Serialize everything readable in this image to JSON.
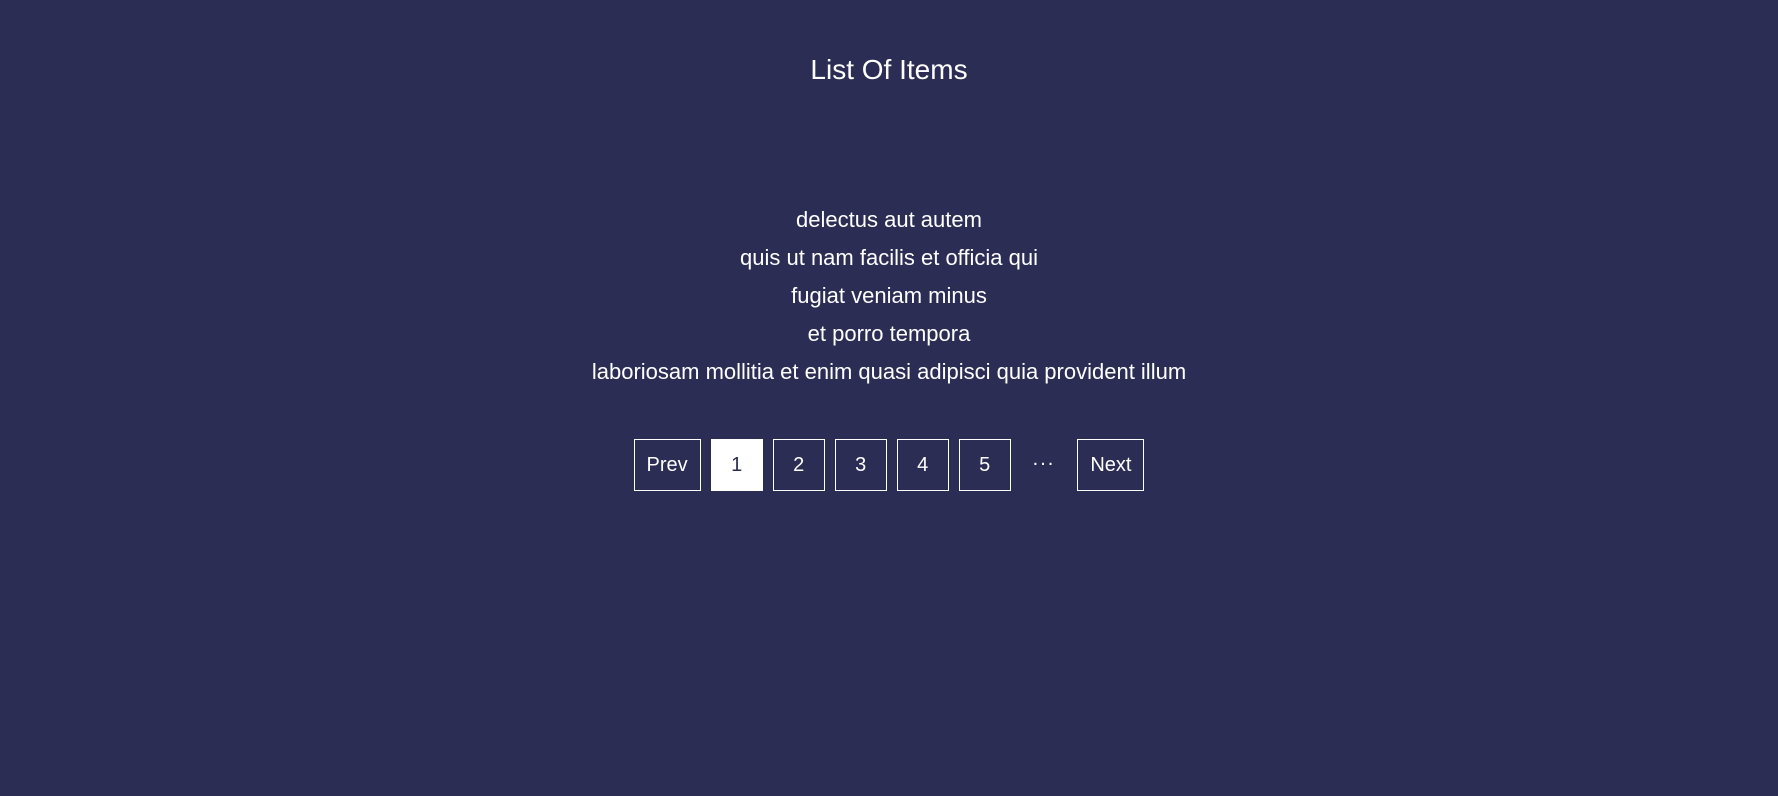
{
  "title": "List Of Items",
  "items": [
    "delectus aut autem",
    "quis ut nam facilis et officia qui",
    "fugiat veniam minus",
    "et porro tempora",
    "laboriosam mollitia et enim quasi adipisci quia provident illum"
  ],
  "pagination": {
    "prev_label": "Prev",
    "next_label": "Next",
    "pages": [
      "1",
      "2",
      "3",
      "4",
      "5"
    ],
    "ellipsis": "...",
    "active_index": 0
  }
}
